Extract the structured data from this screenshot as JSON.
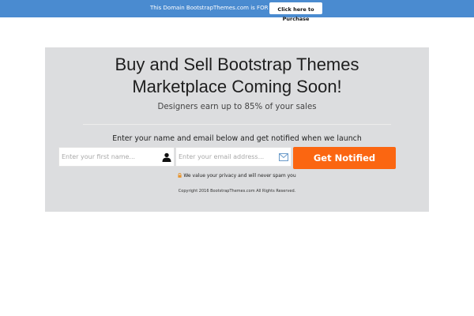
{
  "topbar": {
    "message": "This Domain BootstrapThemes.com is FOR SALE",
    "button_label": "Click here to Purchase"
  },
  "hero": {
    "title_line1": "Buy and Sell Bootstrap Themes",
    "title_line2": "Marketplace Coming Soon!",
    "subtitle": "Designers earn up to 85% of your sales"
  },
  "signup": {
    "instruction": "Enter your name and email below and get notified when we launch",
    "name_placeholder": "Enter your first name...",
    "name_icon": "user-icon",
    "email_placeholder": "Enter your email address...",
    "email_icon": "envelope-icon",
    "submit_label": "Get Notified",
    "privacy_text": "We value your privacy and will never spam you",
    "privacy_icon": "lock-icon"
  },
  "footer": {
    "copyright": "Copyright 2016 BootstrapThemes.com All Rights Reserved."
  },
  "colors": {
    "topbar": "#4a8bd0",
    "panel": "#dcdddf",
    "accent": "#fb6611"
  }
}
